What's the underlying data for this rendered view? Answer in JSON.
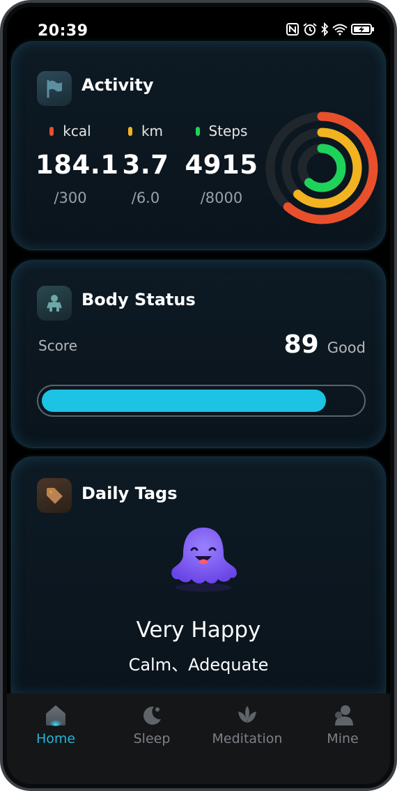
{
  "status_bar": {
    "time": "20:39",
    "icons": [
      "nfc-icon",
      "alarm-icon",
      "bluetooth-icon",
      "wifi-icon",
      "battery-charging-icon"
    ]
  },
  "activity": {
    "title": "Activity",
    "icon": "flag-icon",
    "metrics": [
      {
        "label": "kcal",
        "value": "184.1",
        "goal": "/300",
        "color": "#e8502c",
        "progress": 0.614
      },
      {
        "label": "km",
        "value": "3.7",
        "goal": "/6.0",
        "color": "#f2b320",
        "progress": 0.617
      },
      {
        "label": "Steps",
        "value": "4915",
        "goal": "/8000",
        "color": "#1ed35a",
        "progress": 0.614
      }
    ]
  },
  "body_status": {
    "title": "Body Status",
    "icon": "person-icon",
    "score_label": "Score",
    "score": "89",
    "score_word": "Good",
    "score_fraction": 0.89,
    "bar_color": "#1cc3e4"
  },
  "daily_tags": {
    "title": "Daily Tags",
    "icon": "tag-icon",
    "mood": "Very Happy",
    "tags": "Calm、Adequate",
    "mascot": "happy-ghost-icon",
    "mascot_color": "#7b5cf0"
  },
  "tab_bar": {
    "active": "Home",
    "active_color": "#22b6d9",
    "tabs": [
      {
        "label": "Home",
        "icon": "home-icon"
      },
      {
        "label": "Sleep",
        "icon": "moon-icon"
      },
      {
        "label": "Meditation",
        "icon": "lotus-icon"
      },
      {
        "label": "Mine",
        "icon": "user-icon"
      }
    ]
  }
}
